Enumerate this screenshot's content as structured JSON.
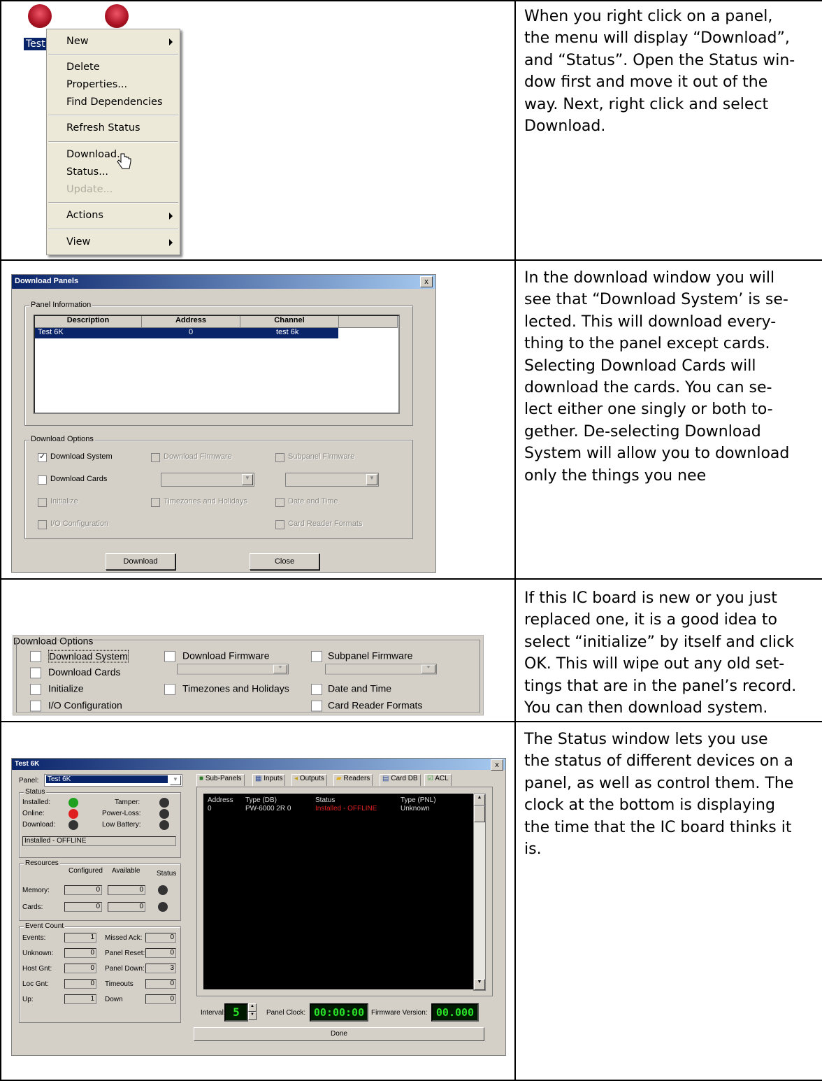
{
  "rows": [
    {
      "text": "When you right click on a panel, the menu will display “Download”, and “Status”. Open the Status window first and move it out of the way. Next, right click and select Download."
    },
    {
      "text": "In the download window you will see that “Download System’ is selected. This will download everything to the panel except cards. Selecting Download Cards will download the cards. You can select either one singly or both together. De-selecting Download System will allow you to download only the things you nee"
    },
    {
      "text": "If this IC board is new or you just replaced one, it is a good idea to select “initialize” by itself and click OK. This will wipe out any old settings that are in the panel’s record. You can then download system."
    },
    {
      "text": "The Status window lets you use the status of different devices on a panel, as well as control them. The clock at the bottom is displaying the time that the IC board thinks it is."
    }
  ],
  "row1_lines": [
    "When you right click on a panel,",
    "the menu will display “Download”,",
    "and “Status”. Open the Status win-",
    "dow first and move it out of the",
    "way. Next, right click and select",
    "Download."
  ],
  "row2_lines": [
    "In the download window you will",
    "see that “Download System’ is se-",
    "lected. This will download every-",
    "thing to the panel except cards.",
    "Selecting Download Cards will",
    "download the cards. You can se-",
    "lect either one singly or both to-",
    "gether. De-selecting Download",
    "System will allow you to download",
    "only the things you nee"
  ],
  "row3_lines": [
    "If this IC board is new or you just",
    "replaced one, it is a good idea to",
    "select “initialize” by itself and click",
    "OK. This will wipe out any old set-",
    "tings that are in the panel’s record.",
    "You can then download system."
  ],
  "row4_lines": [
    "The Status window lets you use",
    "the status of different devices on a",
    "panel, as well as control them. The",
    "clock at the bottom is displaying",
    "the time that the IC board thinks it",
    "is."
  ],
  "context_menu": {
    "icon_label": "Test",
    "items": [
      "New",
      "Delete",
      "Properties...",
      "Find Dependencies",
      "Refresh Status",
      "Download...",
      "Status...",
      "Update...",
      "Actions",
      "View"
    ]
  },
  "download_dialog": {
    "title": "Download Panels",
    "close": "x",
    "panel_info_label": "Panel Information",
    "columns": [
      "Description",
      "Address",
      "Channel"
    ],
    "row": [
      "Test 6K",
      "0",
      "test 6k"
    ],
    "options_label": "Download Options",
    "options": {
      "download_system": "Download System",
      "download_firmware": "Download Firmware",
      "subpanel_firmware": "Subpanel Firmware",
      "download_cards": "Download Cards",
      "initialize": "Initialize",
      "timezones": "Timezones and Holidays",
      "date_time": "Date and Time",
      "io_config": "I/O Configuration",
      "card_reader": "Card Reader Formats"
    },
    "download_btn": "Download",
    "close_btn": "Close"
  },
  "status_window": {
    "title": "Test 6K",
    "panel_label": "Panel:",
    "panel_value": "Test 6K",
    "status_group": "Status",
    "installed": "Installed:",
    "online": "Online:",
    "download": "Download:",
    "tamper": "Tamper:",
    "power_loss": "Power-Loss:",
    "low_battery": "Low Battery:",
    "status_text": "Installed - OFFLINE",
    "resources_group": "Resources",
    "configured": "Configured",
    "available": "Available",
    "status_col": "Status",
    "memory": "Memory:",
    "cards": "Cards:",
    "memory_conf": "0",
    "memory_avail": "0",
    "cards_conf": "0",
    "cards_avail": "0",
    "event_group": "Event Count",
    "events": "Events:",
    "events_v": "1",
    "unknown": "Unknown:",
    "unknown_v": "0",
    "host_gnt": "Host Gnt:",
    "host_gnt_v": "0",
    "loc_gnt": "Loc Gnt:",
    "loc_gnt_v": "0",
    "up": "Up:",
    "up_v": "1",
    "missed_ack": "Missed Ack:",
    "missed_ack_v": "0",
    "panel_reset": "Panel Reset:",
    "panel_reset_v": "0",
    "panel_down": "Panel Down:",
    "panel_down_v": "3",
    "timeouts": "Timeouts",
    "timeouts_v": "0",
    "down": "Down",
    "down_v": "0",
    "tabs": [
      "Sub-Panels",
      "Inputs",
      "Outputs",
      "Readers",
      "Card DB",
      "ACL"
    ],
    "grid_cols": [
      "Address",
      "Type (DB)",
      "Status",
      "Type (PNL)"
    ],
    "grid_row": [
      "0",
      "PW-6000 2R 0",
      "Installed - OFFLINE",
      "Unknown"
    ],
    "interval": "Interval:",
    "interval_v": "5",
    "panel_clock": "Panel Clock:",
    "clock_v": "00:00:00",
    "firmware": "Firmware Version:",
    "firmware_v": "00.000",
    "done": "Done"
  },
  "colors": {
    "title_bar": "#0a246a",
    "led_green": "#20a020",
    "led_red": "#e02020",
    "lcd_green": "#29e329"
  }
}
